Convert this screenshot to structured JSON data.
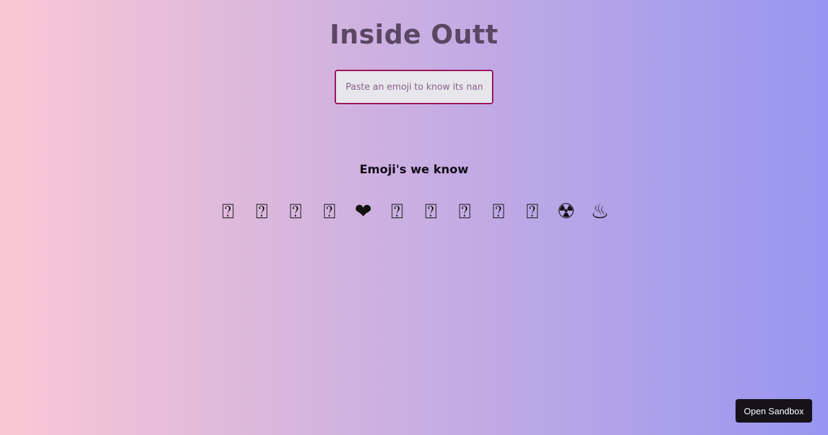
{
  "app": {
    "title": "Inside Outt"
  },
  "search": {
    "placeholder": "Paste an emoji to know its name",
    "value": ""
  },
  "known_emojis": {
    "heading": "Emoji's we know",
    "items": [
      "⍰",
      "⍰",
      "⍰",
      "⍰",
      "❤",
      "⍰",
      "⍰",
      "⍰",
      "⍰",
      "⍰",
      "☢",
      "♨"
    ]
  },
  "sandbox": {
    "label": "Open Sandbox"
  },
  "colors": {
    "gradient_start": "#fbc7d4",
    "gradient_end": "#9796f0",
    "title": "#5b4763",
    "input_border": "#9b1259",
    "input_background": "#e7e6ea",
    "button_background": "#151317"
  }
}
